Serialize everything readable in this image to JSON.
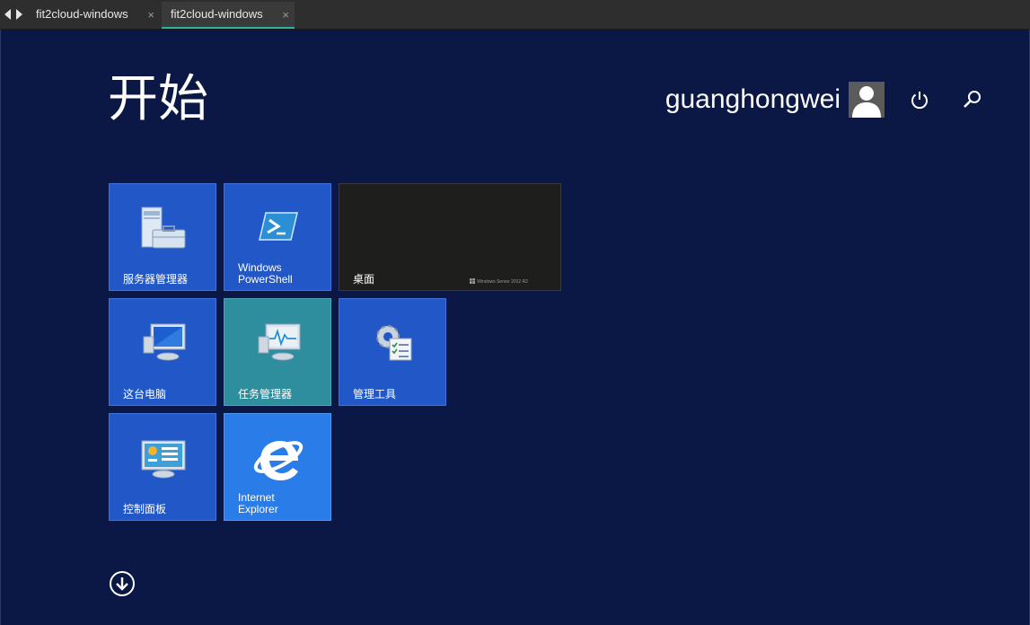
{
  "tabs": [
    {
      "label": "fit2cloud-windows",
      "close": "×"
    },
    {
      "label": "fit2cloud-windows",
      "close": "×"
    }
  ],
  "start": {
    "title": "开始",
    "user_name": "guanghongwei"
  },
  "tiles": [
    {
      "label": "服务器管理器",
      "icon": "server-manager-icon"
    },
    {
      "label": "Windows\nPowerShell",
      "icon": "powershell-icon"
    },
    {
      "label": "桌面",
      "brand": "Windows Server 2012 R2"
    },
    {
      "label": "这台电脑",
      "icon": "computer-icon"
    },
    {
      "label": "任务管理器",
      "icon": "task-manager-icon"
    },
    {
      "label": "管理工具",
      "icon": "admin-tools-icon"
    },
    {
      "label": "控制面板",
      "icon": "control-panel-icon"
    },
    {
      "label": "Internet\nExplorer",
      "icon": "internet-explorer-icon"
    }
  ],
  "colors": {
    "background": "#0b1845",
    "tile_blue": "#2257c7",
    "tile_teal": "#2f8e9e",
    "tile_ie": "#2a7de8",
    "tab_accent": "#2fb39a"
  }
}
